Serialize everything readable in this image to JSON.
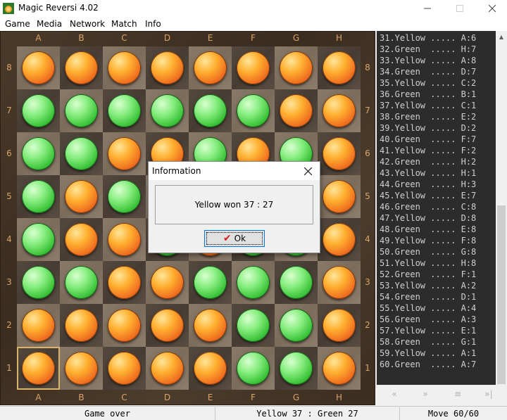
{
  "window": {
    "title": "Magic Reversi 4.02"
  },
  "menu": [
    "Game",
    "Media",
    "Network",
    "Match",
    "Info"
  ],
  "board": {
    "columns": [
      "A",
      "B",
      "C",
      "D",
      "E",
      "F",
      "G",
      "H"
    ],
    "rows": [
      "8",
      "7",
      "6",
      "5",
      "4",
      "3",
      "2",
      "1"
    ],
    "highlight": "A1",
    "grid": [
      "YYYYYYYY",
      "GGGGGGYY",
      "GGYYGYGY",
      "GYGYGGGY",
      "GYYGYGGY",
      "GGYYGGGY",
      "YYYYYGGY",
      "YYYYYGGY"
    ]
  },
  "history": [
    "31.Yellow ..... A:6",
    "32.Green  ..... H:7",
    "33.Yellow ..... A:8",
    "34.Green  ..... D:7",
    "35.Yellow ..... C:2",
    "36.Green  ..... B:1",
    "37.Yellow ..... C:1",
    "38.Green  ..... E:2",
    "39.Yellow ..... D:2",
    "40.Green  ..... F:7",
    "41.Yellow ..... F:2",
    "42.Green  ..... H:2",
    "43.Yellow ..... H:1",
    "44.Green  ..... H:3",
    "45.Yellow ..... E:7",
    "46.Green  ..... C:8",
    "47.Yellow ..... D:8",
    "48.Green  ..... E:8",
    "49.Yellow ..... F:8",
    "50.Green  ..... G:8",
    "51.Yellow ..... H:8",
    "52.Green  ..... F:1",
    "53.Yellow ..... A:2",
    "54.Green  ..... D:1",
    "55.Yellow ..... A:4",
    "56.Green  ..... A:3",
    "57.Yellow ..... E:1",
    "58.Green  ..... G:1",
    "59.Yellow ..... A:1",
    "60.Green  ..... A:7"
  ],
  "status": {
    "state": "Game over",
    "score": "Yellow 37 : Green 27",
    "move": "Move 60/60"
  },
  "dialog": {
    "title": "Information",
    "message": "Yellow won 37 : 27",
    "ok_label": "Ok"
  },
  "colors": {
    "yellow_disc": "#f08a2a",
    "green_disc": "#4ccc44",
    "highlight": "#d8b468"
  }
}
